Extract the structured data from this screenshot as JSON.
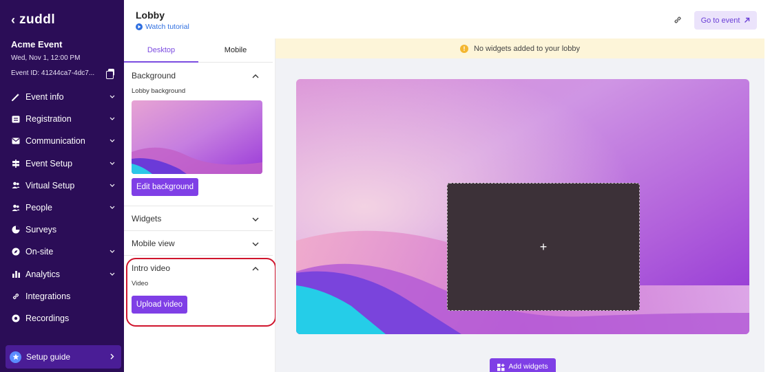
{
  "sidebar": {
    "back_glyph": "‹",
    "brand": "zuddl",
    "event_name": "Acme Event",
    "event_date": "Wed, Nov 1, 12:00 PM",
    "event_id": "Event ID: 41244ca7-4dc7...",
    "items": [
      {
        "label": "Event info",
        "icon": "magic-wand-icon",
        "has_chevron": true
      },
      {
        "label": "Registration",
        "icon": "form-icon",
        "has_chevron": true
      },
      {
        "label": "Communication",
        "icon": "envelope-icon",
        "has_chevron": true
      },
      {
        "label": "Event Setup",
        "icon": "signpost-icon",
        "has_chevron": true
      },
      {
        "label": "Virtual Setup",
        "icon": "users-icon",
        "has_chevron": true
      },
      {
        "label": "People",
        "icon": "users-icon",
        "has_chevron": true
      },
      {
        "label": "Surveys",
        "icon": "pie-chart-icon",
        "has_chevron": false
      },
      {
        "label": "On-site",
        "icon": "compass-icon",
        "has_chevron": true
      },
      {
        "label": "Analytics",
        "icon": "bar-chart-icon",
        "has_chevron": true
      },
      {
        "label": "Integrations",
        "icon": "link-icon",
        "has_chevron": false
      },
      {
        "label": "Recordings",
        "icon": "record-icon",
        "has_chevron": false
      }
    ],
    "setup_guide": {
      "label": "Setup guide",
      "icon": "star-badge-icon"
    }
  },
  "header": {
    "title": "Lobby",
    "watch_tutorial": "Watch tutorial",
    "go_to_event": "Go to event"
  },
  "panel": {
    "tabs": [
      {
        "label": "Desktop",
        "active": true
      },
      {
        "label": "Mobile",
        "active": false
      }
    ],
    "background": {
      "title": "Background",
      "sub_label": "Lobby background",
      "button": "Edit background"
    },
    "widgets": {
      "title": "Widgets"
    },
    "mobile_view": {
      "title": "Mobile view"
    },
    "intro_video": {
      "title": "Intro video",
      "sub_label": "Video",
      "button": "Upload video"
    }
  },
  "main": {
    "banner": "No widgets added to your lobby",
    "add_widgets": "Add widgets",
    "video_placeholder": "+"
  },
  "colors": {
    "sidebar_bg": "#2b0d57",
    "accent": "#7f3fe6",
    "banner_bg": "#fdf5d9",
    "highlight": "#d0142c"
  }
}
